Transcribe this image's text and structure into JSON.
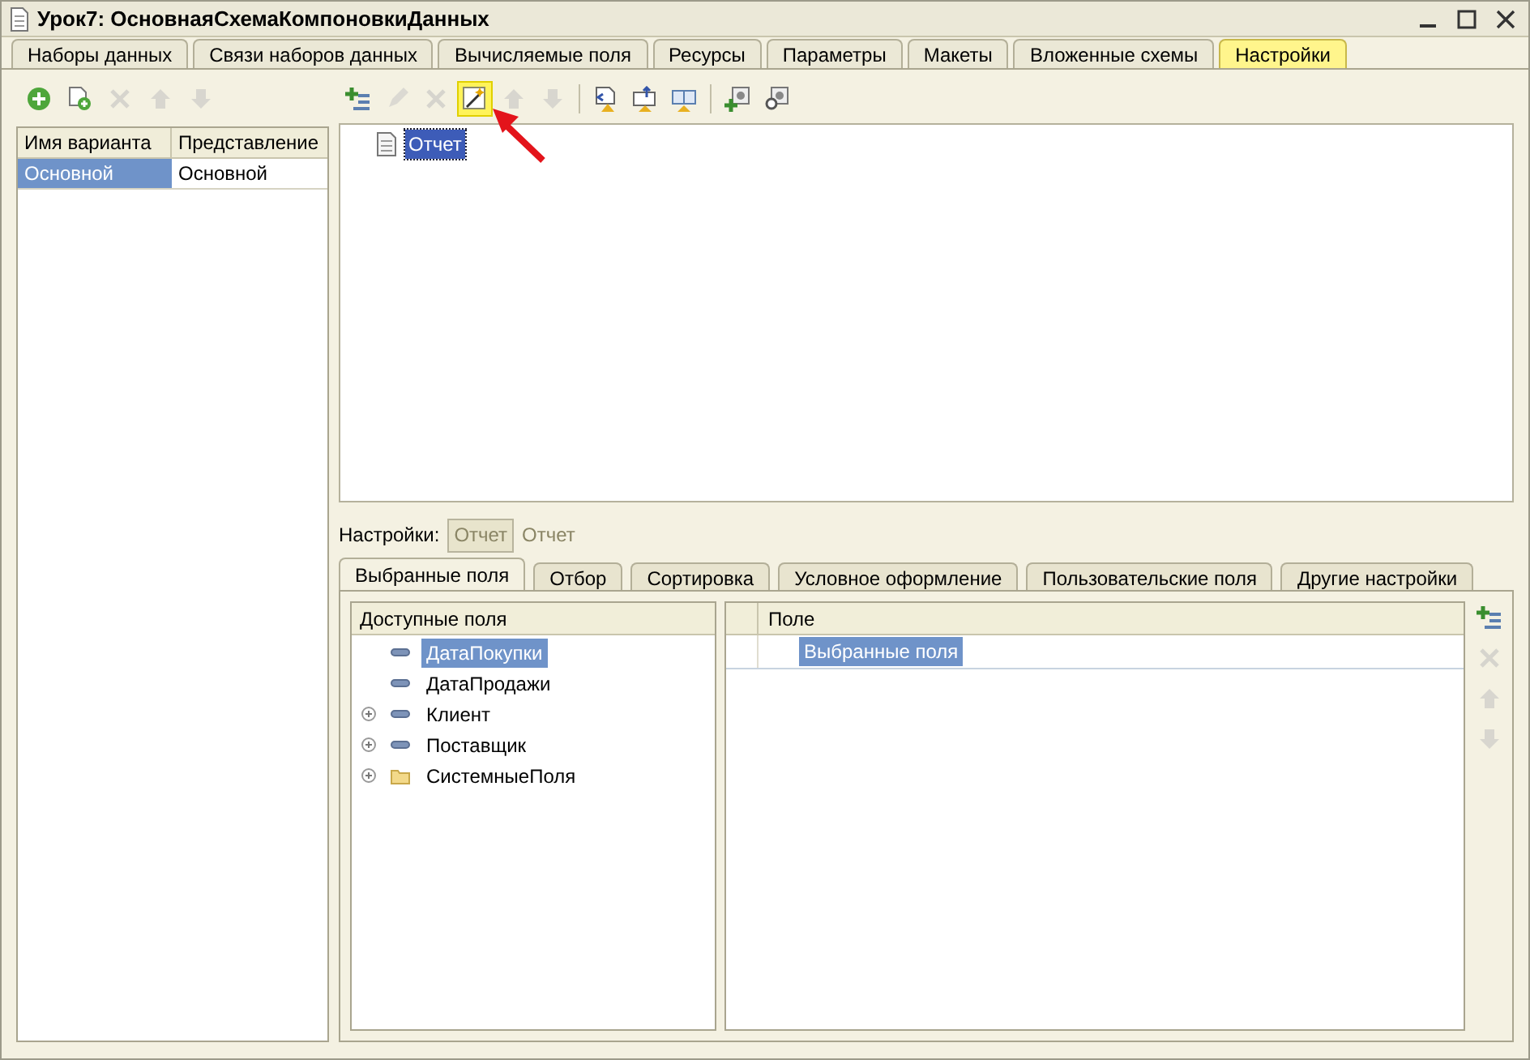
{
  "window": {
    "title": "Урок7: ОсновнаяСхемаКомпоновкиДанных"
  },
  "tabs": [
    {
      "label": "Наборы данных",
      "selected": false
    },
    {
      "label": "Связи наборов данных",
      "selected": false
    },
    {
      "label": "Вычисляемые поля",
      "selected": false
    },
    {
      "label": "Ресурсы",
      "selected": false
    },
    {
      "label": "Параметры",
      "selected": false
    },
    {
      "label": "Макеты",
      "selected": false
    },
    {
      "label": "Вложенные схемы",
      "selected": false
    },
    {
      "label": "Настройки",
      "selected": true
    }
  ],
  "variants": {
    "toolbar": [
      {
        "kind": "add",
        "disabled": false
      },
      {
        "kind": "copy",
        "disabled": false
      },
      {
        "kind": "delete",
        "disabled": true
      },
      {
        "kind": "up",
        "disabled": true
      },
      {
        "kind": "down",
        "disabled": true
      }
    ],
    "columns": [
      "Имя варианта",
      "Представление"
    ],
    "rows": [
      {
        "cells": [
          "Основной",
          "Основной"
        ],
        "selected": true
      }
    ]
  },
  "structure": {
    "toolbar": [
      {
        "kind": "add-list",
        "disabled": false,
        "highlighted": false
      },
      {
        "kind": "edit",
        "disabled": true,
        "highlighted": false
      },
      {
        "kind": "delete",
        "disabled": true,
        "highlighted": false
      },
      {
        "kind": "wizard",
        "disabled": false,
        "highlighted": true
      },
      {
        "kind": "up",
        "disabled": true,
        "highlighted": false
      },
      {
        "kind": "down",
        "disabled": true,
        "highlighted": false
      },
      {
        "kind": "separator"
      },
      {
        "kind": "doc-back",
        "disabled": false,
        "highlighted": false
      },
      {
        "kind": "book-up",
        "disabled": false,
        "highlighted": false
      },
      {
        "kind": "book-down",
        "disabled": false,
        "highlighted": false
      },
      {
        "kind": "separator"
      },
      {
        "kind": "gear-add",
        "disabled": false,
        "highlighted": false
      },
      {
        "kind": "gear-find",
        "disabled": false,
        "highlighted": false
      }
    ],
    "items": [
      {
        "label": "Отчет",
        "selected": true
      }
    ]
  },
  "settings_bar": {
    "label": "Настройки:",
    "button": "Отчет",
    "link": "Отчет"
  },
  "settings_tabs": [
    {
      "label": "Выбранные поля",
      "selected": true
    },
    {
      "label": "Отбор",
      "selected": false
    },
    {
      "label": "Сортировка",
      "selected": false
    },
    {
      "label": "Условное оформление",
      "selected": false
    },
    {
      "label": "Пользовательские поля",
      "selected": false
    },
    {
      "label": "Другие настройки",
      "selected": false
    }
  ],
  "available_fields": {
    "header": "Доступные поля",
    "items": [
      {
        "label": "ДатаПокупки",
        "kind": "field",
        "expandable": false,
        "selected": true
      },
      {
        "label": "ДатаПродажи",
        "kind": "field",
        "expandable": false,
        "selected": false
      },
      {
        "label": "Клиент",
        "kind": "field",
        "expandable": true,
        "selected": false
      },
      {
        "label": "Поставщик",
        "kind": "field",
        "expandable": true,
        "selected": false
      },
      {
        "label": "СистемныеПоля",
        "kind": "folder",
        "expandable": true,
        "selected": false
      }
    ]
  },
  "selected_fields": {
    "header": "Поле",
    "rows": [
      {
        "label": "Выбранные поля",
        "selected": true
      }
    ],
    "toolbar": [
      {
        "kind": "add-list",
        "disabled": false
      },
      {
        "kind": "delete",
        "disabled": true
      },
      {
        "kind": "up",
        "disabled": true
      },
      {
        "kind": "down",
        "disabled": true
      }
    ]
  }
}
